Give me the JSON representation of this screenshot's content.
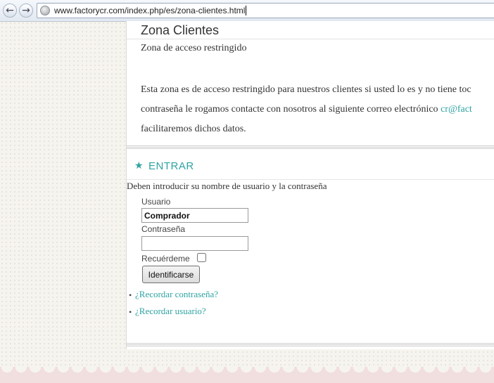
{
  "browser": {
    "back_icon": "arrow-left-icon",
    "forward_icon": "arrow-right-icon",
    "url": "www.factorycr.com/index.php/es/zona-clientes.html"
  },
  "page": {
    "title": "Zona Clientes",
    "subtitle": "Zona de acceso restringido",
    "paragraph": {
      "line1": "Esta zona es de acceso restringido para nuestros clientes si usted lo es y no tiene toc",
      "line2_text": "contraseña le rogamos contacte con nosotros al siguiente correo electrónico ",
      "email": "cr@fact",
      "line3": "facilitaremos dichos datos."
    }
  },
  "login": {
    "heading": "ENTRAR",
    "instructions": "Deben introducir su nombre de usuario y la contraseña",
    "username_label": "Usuario",
    "username_value": "Comprador",
    "password_label": "Contraseña",
    "password_value": "",
    "remember_label": "Recuérdeme",
    "remember_checked": false,
    "submit_label": "Identificarse",
    "links": [
      "¿Recordar contraseña?",
      "¿Recordar usuario?"
    ]
  },
  "colors": {
    "accent": "#2fa3a3",
    "text": "#333333",
    "background": "#f6f4ee"
  }
}
